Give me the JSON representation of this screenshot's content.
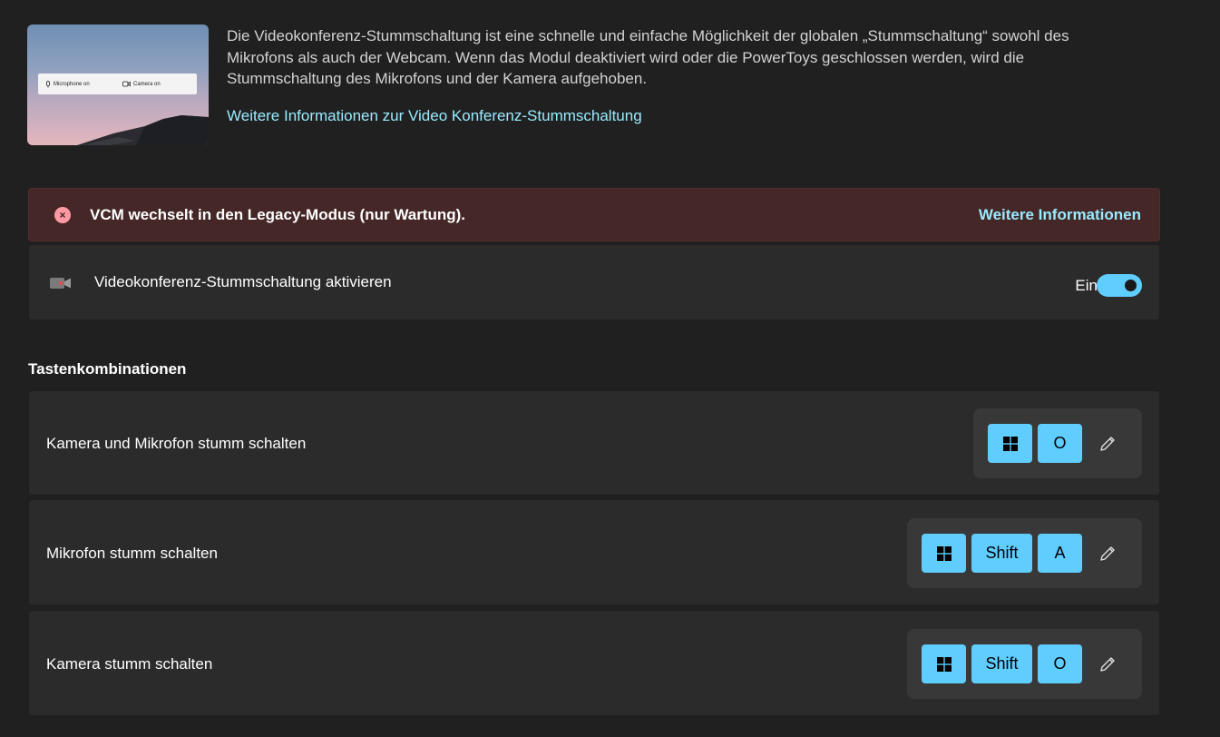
{
  "hero": {
    "preview_mic": "Microphone on",
    "preview_cam": "Camera on",
    "description": "Die Videokonferenz-Stummschaltung ist eine schnelle und einfache Möglichkeit der globalen „Stummschaltung“ sowohl des Mikrofons als auch der Webcam. Wenn das Modul deaktiviert wird oder die PowerToys geschlossen werden, wird die Stummschaltung des Mikrofons und der Kamera aufgehoben.",
    "learn_more": "Weitere Informationen zur Video Konferenz-Stummschaltung"
  },
  "banner": {
    "message": "VCM wechselt in den Legacy-Modus (nur Wartung).",
    "link": "Weitere Informationen",
    "color": "#442726"
  },
  "enable": {
    "label": "Videokonferenz-Stummschaltung aktivieren",
    "state_label": "Ein",
    "on": true
  },
  "shortcuts": {
    "title": "Tastenkombinationen",
    "items": [
      {
        "label": "Kamera und Mikrofon stumm schalten",
        "keys": [
          "win",
          "O"
        ]
      },
      {
        "label": "Mikrofon stumm schalten",
        "keys": [
          "win",
          "Shift",
          "A"
        ]
      },
      {
        "label": "Kamera stumm schalten",
        "keys": [
          "win",
          "Shift",
          "O"
        ]
      }
    ]
  },
  "colors": {
    "accent": "#60cdff",
    "link": "#99ebff",
    "background": "#202020",
    "card": "#2b2b2b"
  }
}
